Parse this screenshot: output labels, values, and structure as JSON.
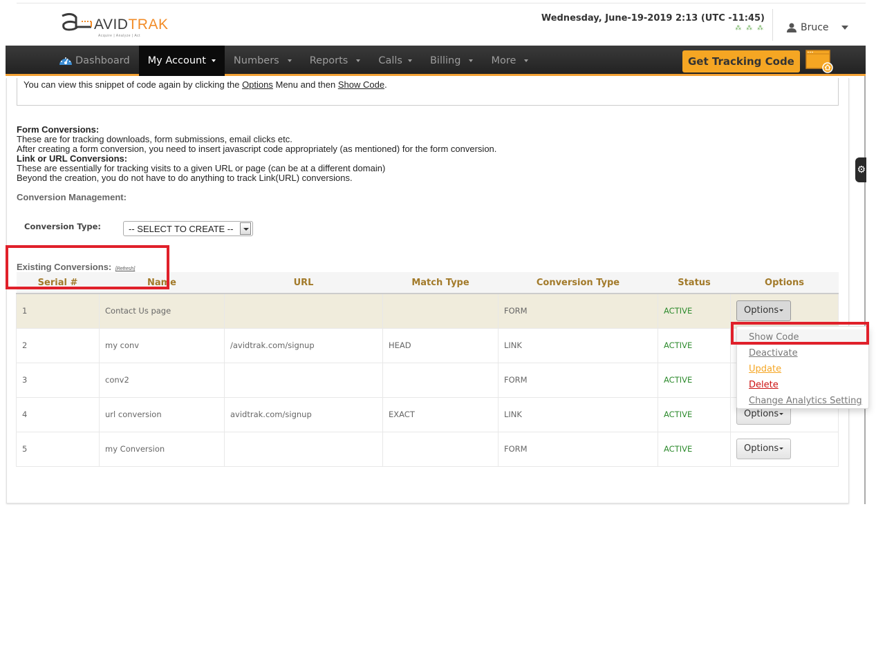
{
  "header": {
    "logo": {
      "brand_left": "AVID",
      "brand_right": "TRAK",
      "tagline": "Acquire  |  Analyze  |  Act"
    },
    "datetime": "Wednesday, June-19-2019 2:13 (UTC -11:45)",
    "datetime_sub": "ᨀᨀᨀ",
    "user": {
      "name": "Bruce",
      "icon": "user-icon"
    }
  },
  "nav": {
    "items": [
      {
        "label": "Dashboard",
        "icon": "dashboard-gauge-icon",
        "active": false,
        "caret": false
      },
      {
        "label": "My Account",
        "active": true,
        "caret": true
      },
      {
        "label": "Numbers",
        "active": false,
        "caret": true
      },
      {
        "label": "Reports",
        "active": false,
        "caret": true
      },
      {
        "label": "Calls",
        "active": false,
        "caret": true
      },
      {
        "label": "Billing",
        "active": false,
        "caret": true
      },
      {
        "label": "More",
        "active": false,
        "caret": true
      }
    ],
    "tracking_button": "Get Tracking Code",
    "tracking_icon": "browser-home-icon",
    "colors": {
      "accent": "#f5a623",
      "nav_bg": "#2b2b2b"
    }
  },
  "snippet": {
    "pre": "You can view this snippet of code again by clicking the ",
    "link1": "Options",
    "mid": " Menu and then ",
    "link2": "Show Code",
    "post": "."
  },
  "info": {
    "form_title": "Form Conversions:",
    "form_line1": "These are for tracking downloads, form submissions, email clicks etc.",
    "form_line2": "After creating a form conversion, you need to insert javascript code appropriately (as mentioned) for the form conversion.",
    "link_title": "Link or URL Conversions:",
    "link_line1": "These are essentially for tracking visits to a given URL or page (can be at a different domain)",
    "link_line2": "Beyond the creation, you do not have to do anything to track Link(URL) conversions."
  },
  "management": {
    "title": "Conversion Management:",
    "type_label": "Conversion Type:",
    "type_selected": "-- SELECT TO CREATE --"
  },
  "existing": {
    "title": "Existing Conversions:",
    "refresh": "[Refresh]"
  },
  "table": {
    "columns": [
      "Serial #",
      "Name",
      "URL",
      "Match Type",
      "Conversion Type",
      "Status",
      "Options"
    ],
    "rows": [
      {
        "serial": "1",
        "name": "Contact Us page",
        "url": "",
        "match": "",
        "type": "FORM",
        "status": "ACTIVE",
        "options": "Options"
      },
      {
        "serial": "2",
        "name": "my conv",
        "url": "/avidtrak.com/signup",
        "match": "HEAD",
        "type": "LINK",
        "status": "ACTIVE",
        "options": "Options"
      },
      {
        "serial": "3",
        "name": "conv2",
        "url": "",
        "match": "",
        "type": "FORM",
        "status": "ACTIVE",
        "options": "Options"
      },
      {
        "serial": "4",
        "name": "url conversion",
        "url": "avidtrak.com/signup",
        "match": "EXACT",
        "type": "LINK",
        "status": "ACTIVE",
        "options": "Options"
      },
      {
        "serial": "5",
        "name": "my Conversion",
        "url": "",
        "match": "",
        "type": "FORM",
        "status": "ACTIVE",
        "options": "Options"
      }
    ],
    "status_color": "#2e8b2e",
    "header_color": "#a27a2a"
  },
  "options_menu": {
    "items": [
      {
        "label": "Show Code",
        "color": "#777777"
      },
      {
        "label": "Deactivate",
        "color": "#777777"
      },
      {
        "label": "Update",
        "color": "#f5a623"
      },
      {
        "label": "Delete",
        "color": "#cc1111"
      },
      {
        "label": "Change Analytics Setting",
        "color": "#777777"
      }
    ]
  },
  "annotation_color": "#e0202a"
}
